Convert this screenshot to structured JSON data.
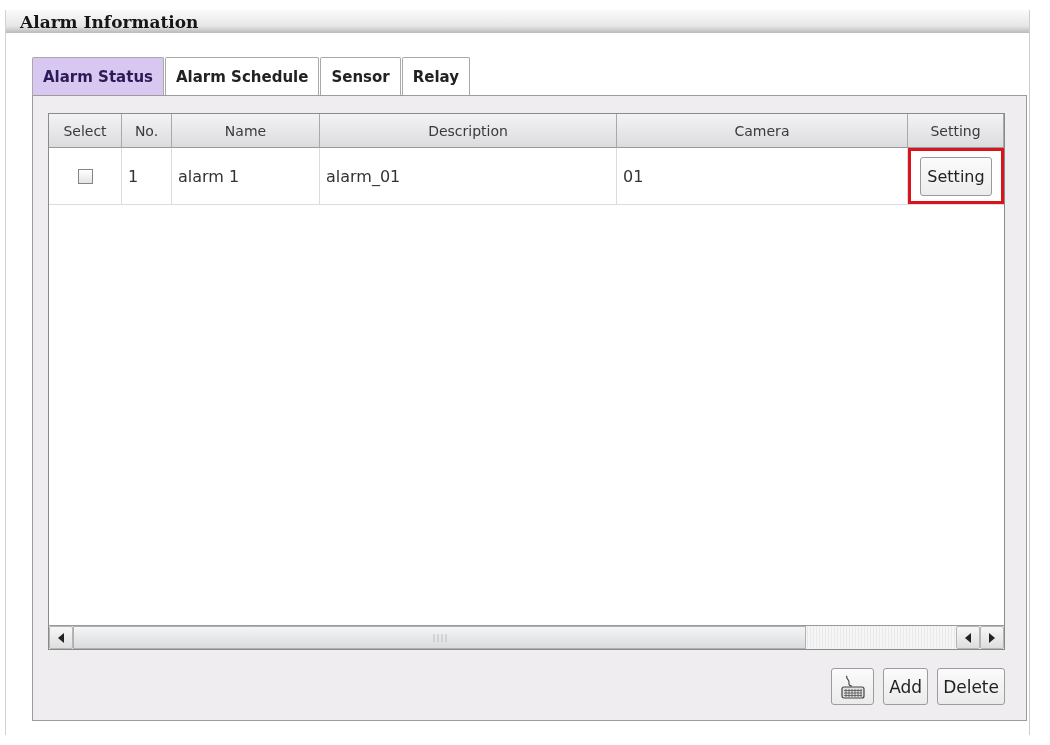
{
  "panel": {
    "title": "Alarm Information"
  },
  "tabs": [
    {
      "label": "Alarm Status",
      "selected": true
    },
    {
      "label": "Alarm Schedule",
      "selected": false
    },
    {
      "label": "Sensor",
      "selected": false
    },
    {
      "label": "Relay",
      "selected": false
    }
  ],
  "table": {
    "columns": [
      "Select",
      "No.",
      "Name",
      "Description",
      "Camera",
      "Setting"
    ],
    "rows": [
      {
        "checked": false,
        "no": "1",
        "name": "alarm 1",
        "description": "alarm_01",
        "camera": "01",
        "button": "Setting",
        "highlighted": true
      }
    ]
  },
  "buttons": [
    {
      "kind": "icon"
    },
    {
      "kind": "text",
      "label": "Add"
    },
    {
      "kind": "text",
      "label": "Delete"
    }
  ]
}
